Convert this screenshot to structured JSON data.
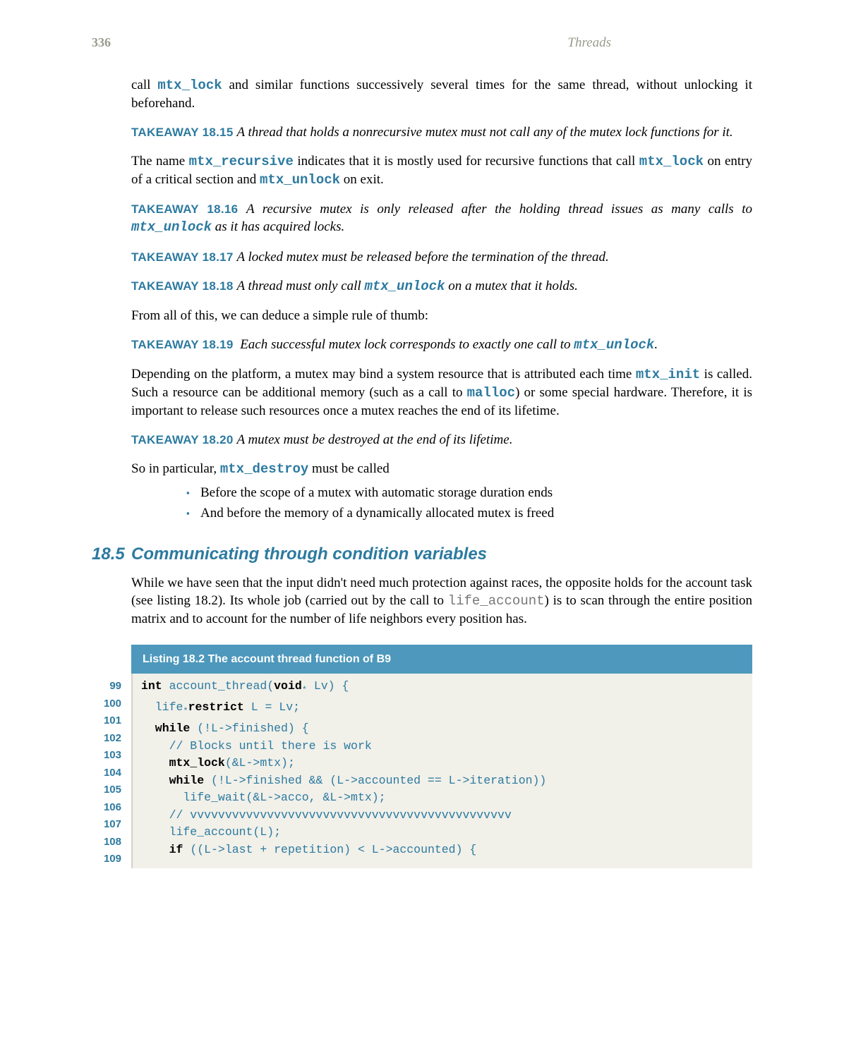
{
  "page_number": "336",
  "running_title": "Threads",
  "p1_t1": "call ",
  "p1_c1": "mtx_lock",
  "p1_t2": " and similar functions successively several times for the same thread, without unlocking it beforehand.",
  "tk15_label": "TAKEAWAY 18.15",
  "tk15_body": "A thread that holds a nonrecursive mutex must not call any of the mutex lock functions for it.",
  "p2_t1": "The name ",
  "p2_c1": "mtx_recursive",
  "p2_t2": " indicates that it is mostly used for recursive functions that call ",
  "p2_c2": "mtx_lock",
  "p2_t3": " on entry of a critical section and ",
  "p2_c3": "mtx_unlock",
  "p2_t4": " on exit.",
  "tk16_label": "TAKEAWAY 18.16",
  "tk16_b1": "A recursive mutex is only released after the holding thread issues as many calls to ",
  "tk16_c1": "mtx_unlock",
  "tk16_b2": " as it has acquired locks.",
  "tk17_label": "TAKEAWAY 18.17",
  "tk17_body": "A locked mutex must be released before the termination of the thread.",
  "tk18_label": "TAKEAWAY 18.18",
  "tk18_b1": "A thread must only call ",
  "tk18_c1": "mtx_unlock",
  "tk18_b2": " on a mutex that it holds.",
  "p3": "From all of this, we can deduce a simple rule of thumb:",
  "tk19_label": "TAKEAWAY 18.19",
  "tk19_b1": "Each successful mutex lock corresponds to exactly one call to ",
  "tk19_c1": "mtx_unlock",
  "tk19_b2": ".",
  "p4_t1": "Depending on the platform, a mutex may bind a system resource that is attributed each time ",
  "p4_c1": "mtx_init",
  "p4_t2": " is called. Such a resource can be additional memory (such as a call to ",
  "p4_c2": "malloc",
  "p4_t3": ") or some special hardware. Therefore, it is important to release such resources once a mutex reaches the end of its lifetime.",
  "tk20_label": "TAKEAWAY 18.20",
  "tk20_body": "A mutex must be destroyed at the end of its lifetime.",
  "p5_t1": "So in particular, ",
  "p5_c1": "mtx_destroy",
  "p5_t2": " must be called",
  "b1": "Before the scope of a mutex with automatic storage duration ends",
  "b2": "And before the memory of a dynamically allocated mutex is freed",
  "sec_num": "18.5",
  "sec_title": "Communicating through condition variables",
  "p6_t1": "While we have seen that the input didn't need much protection against races, the opposite holds for the account task (see listing 18.2). Its whole job (carried out by the call to ",
  "p6_c1": "life_account",
  "p6_t2": ") is to scan through the entire position matrix and to account for the number of life neighbors every position has.",
  "listing_title": "Listing 18.2   The account thread function of B9",
  "lines": {
    "99": "99",
    "100": "100",
    "101": "101",
    "102": "102",
    "103": "103",
    "104": "104",
    "105": "105",
    "106": "106",
    "107": "107",
    "108": "108",
    "109": "109"
  },
  "code": {
    "l99_k1": "int",
    "l99_a": " account_thread(",
    "l99_k2": "void",
    "l99_b": " Lv) {",
    "l100_a": "  life",
    "l100_k1": "restrict",
    "l100_b": " L = Lv;",
    "l101_k1": "  while",
    "l101_a": " (!L->finished) {",
    "l102": "    // Blocks until there is work",
    "l103_k1": "    mtx_lock",
    "l103_a": "(&L->mtx);",
    "l104_k1": "    while",
    "l104_a": " (!L->finished && (L->accounted == L->iteration))",
    "l105": "      life_wait(&L->acco, &L->mtx);",
    "l106": "",
    "l107": "    // vvvvvvvvvvvvvvvvvvvvvvvvvvvvvvvvvvvvvvvvvvvvvv",
    "l108": "    life_account(L);",
    "l109_k1": "    if",
    "l109_a": " ((L->last + repetition) < L->accounted) {"
  }
}
